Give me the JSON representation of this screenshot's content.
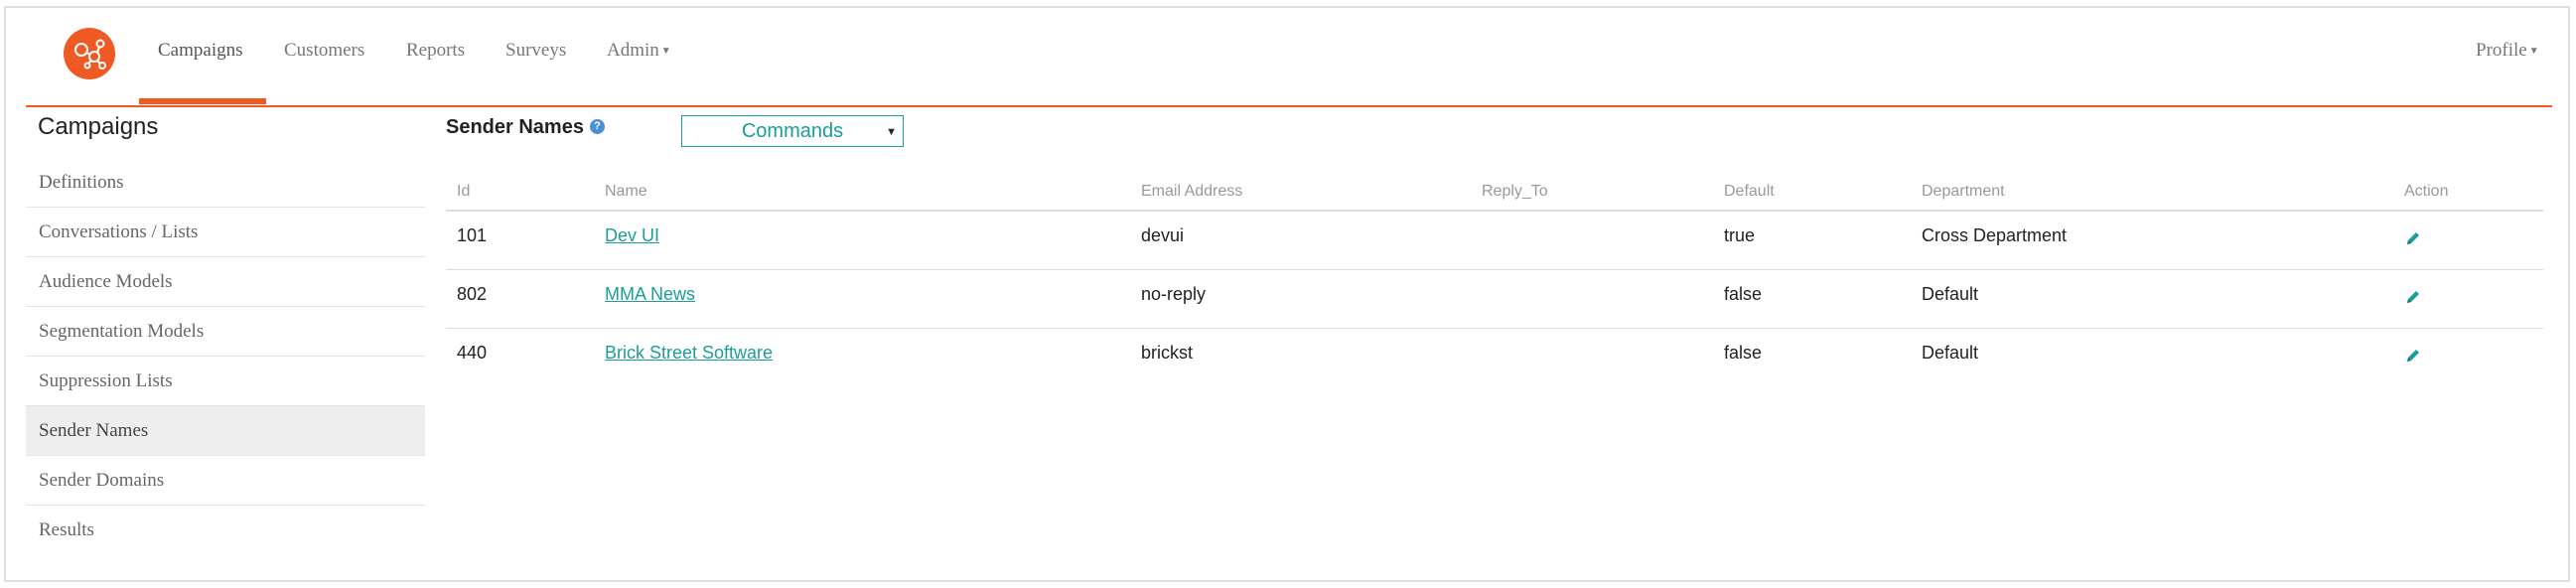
{
  "nav": {
    "items": [
      {
        "label": "Campaigns",
        "active": true
      },
      {
        "label": "Customers"
      },
      {
        "label": "Reports"
      },
      {
        "label": "Surveys"
      },
      {
        "label": "Admin"
      }
    ],
    "profile": "Profile",
    "logo_icon": "network-logo-icon",
    "accent_color": "#ef5a24"
  },
  "sidebar": {
    "title": "Campaigns",
    "items": [
      {
        "label": "Definitions"
      },
      {
        "label": "Conversations / Lists"
      },
      {
        "label": "Audience Models"
      },
      {
        "label": "Segmentation Models"
      },
      {
        "label": "Suppression Lists"
      },
      {
        "label": "Sender Names",
        "active": true
      },
      {
        "label": "Sender Domains"
      },
      {
        "label": "Results"
      }
    ]
  },
  "main": {
    "title": "Sender Names",
    "help_icon": "info-icon",
    "commands_label": "Commands",
    "link_color": "#1a9e97",
    "table": {
      "columns": [
        "Id",
        "Name",
        "Email Address",
        "Reply_To",
        "Default",
        "Department",
        "Action"
      ],
      "rows": [
        {
          "id": "101",
          "name": "Dev UI",
          "email": "devui",
          "reply_to": "",
          "default": "true",
          "department": "Cross Department"
        },
        {
          "id": "802",
          "name": "MMA News",
          "email": "no-reply",
          "reply_to": "",
          "default": "false",
          "department": "Default"
        },
        {
          "id": "440",
          "name": "Brick Street Software",
          "email": "brickst",
          "reply_to": "",
          "default": "false",
          "department": "Default"
        }
      ],
      "action_icon": "pencil-edit-icon"
    }
  }
}
